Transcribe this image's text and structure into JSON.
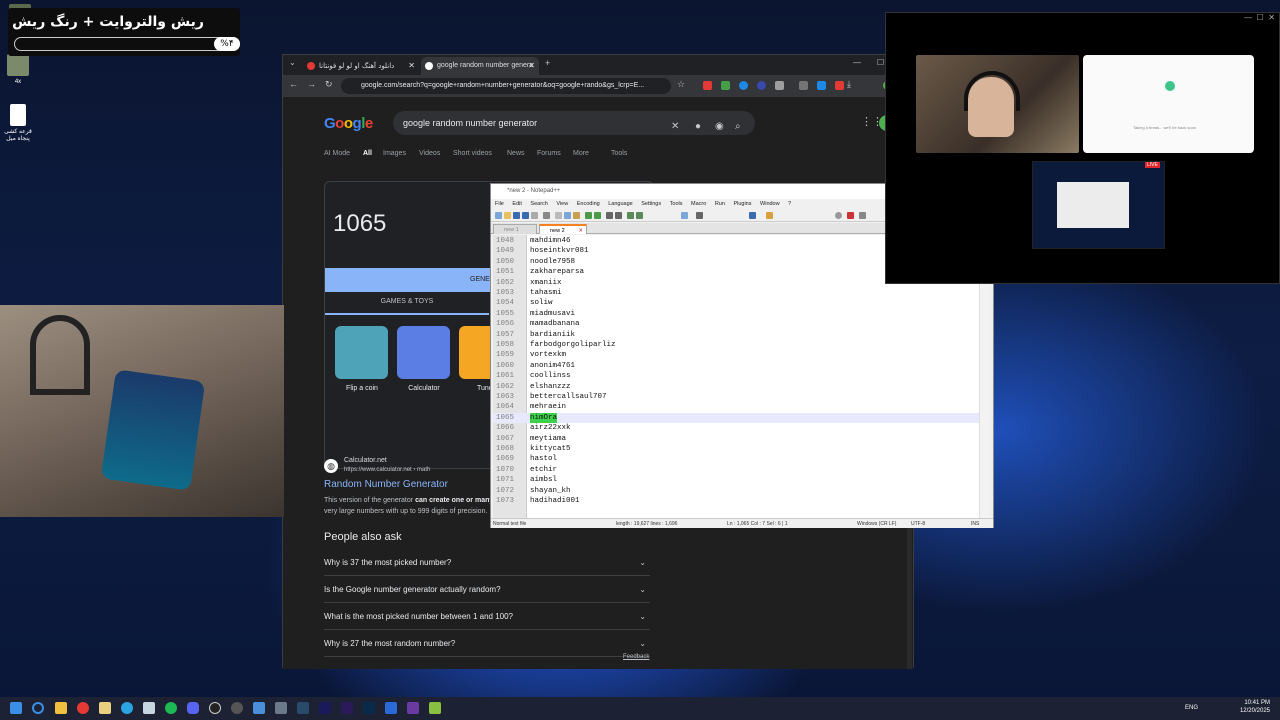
{
  "overlay": {
    "title": "ریش والتروایت + رنگ ریش",
    "percent": "%۴"
  },
  "desktop_icons": [
    {
      "label": "4x"
    },
    {
      "label": "قرعه کشی پنجاه میل"
    }
  ],
  "chrome": {
    "tabs": [
      {
        "label": "دانلود آهنگ او لو لو فونتانا",
        "active": false
      },
      {
        "label": "google random number genera",
        "active": true
      }
    ],
    "url": "google.com/search?q=google+random+number+generator&oq=google+rando&gs_lcrp=E...",
    "search_query": "google random number generator",
    "search_tabs": [
      "AI Mode",
      "All",
      "Images",
      "Videos",
      "Short videos",
      "News",
      "Forums",
      "More",
      "Tools"
    ],
    "rng": {
      "number": "1065",
      "generate_label": "GENERATE",
      "section_label": "GAMES & TOYS",
      "cards": [
        "Flip a coin",
        "Calculator",
        "Tuner"
      ]
    },
    "result": {
      "site": "Calculator.net",
      "url": "https://www.calculator.net › math",
      "title": "Random Number Generator",
      "desc_plain": "This version of the generator ",
      "desc_bold": "can create one or many",
      "desc_rest": "very large numbers with up to 999 digits of precision."
    },
    "paa": {
      "heading": "People also ask",
      "questions": [
        "Why is 37 the most picked number?",
        "Is the Google number generator actually random?",
        "What is the most picked number between 1 and 100?",
        "Why is 27 the most random number?"
      ]
    },
    "feedback": "Feedback"
  },
  "notepad": {
    "title": "*new 2 - Notepad++",
    "menu": [
      "File",
      "Edit",
      "Search",
      "View",
      "Encoding",
      "Language",
      "Settings",
      "Tools",
      "Macro",
      "Run",
      "Plugins",
      "Window",
      "?"
    ],
    "file_tabs": [
      "new 1",
      "new 2"
    ],
    "lines": [
      {
        "n": "1048",
        "t": "mahdimn46"
      },
      {
        "n": "1049",
        "t": "hoseintkvr081"
      },
      {
        "n": "1050",
        "t": "noodle7958"
      },
      {
        "n": "1051",
        "t": "zakhareparsa"
      },
      {
        "n": "1052",
        "t": "xmaniix"
      },
      {
        "n": "1053",
        "t": "tahasmi"
      },
      {
        "n": "1054",
        "t": "soliw"
      },
      {
        "n": "1055",
        "t": "miadmusavi"
      },
      {
        "n": "1056",
        "t": "mamadbanana"
      },
      {
        "n": "1057",
        "t": "bardianiik"
      },
      {
        "n": "1058",
        "t": "farbodgorgoliparliz"
      },
      {
        "n": "1059",
        "t": "vortexkm"
      },
      {
        "n": "1060",
        "t": "anonim4761"
      },
      {
        "n": "1061",
        "t": "coollinss"
      },
      {
        "n": "1062",
        "t": "elshanzzz"
      },
      {
        "n": "1063",
        "t": "bettercallsaul707"
      },
      {
        "n": "1064",
        "t": "mehraein"
      },
      {
        "n": "1065",
        "t": "nimOra",
        "current": true
      },
      {
        "n": "1066",
        "t": "airz22xxk"
      },
      {
        "n": "1067",
        "t": "meytiama"
      },
      {
        "n": "1068",
        "t": "kittycat5"
      },
      {
        "n": "1069",
        "t": "hastol"
      },
      {
        "n": "1070",
        "t": "etchir"
      },
      {
        "n": "1071",
        "t": "aimbsl"
      },
      {
        "n": "1072",
        "t": "shayan_kh"
      },
      {
        "n": "1073",
        "t": "hadihadi001"
      }
    ],
    "status": {
      "type": "Normal text file",
      "length": "length : 19,627   lines : 1,696",
      "pos": "Ln : 1,065   Col : 7   Sel : 6 | 1",
      "eol": "Windows (CR LF)",
      "enc": "UTF-8",
      "mode": "INS"
    }
  },
  "stream": {
    "live": "LIVE",
    "side_text": "Taking a break... we'll be back soon"
  },
  "tray": {
    "lang": "ENG",
    "time": "10:41 PM",
    "date": "12/20/2025"
  },
  "colors": {
    "accent_blue": "#8ab4f8",
    "highlight_green": "#3cd04c",
    "live_red": "#e0252c"
  }
}
